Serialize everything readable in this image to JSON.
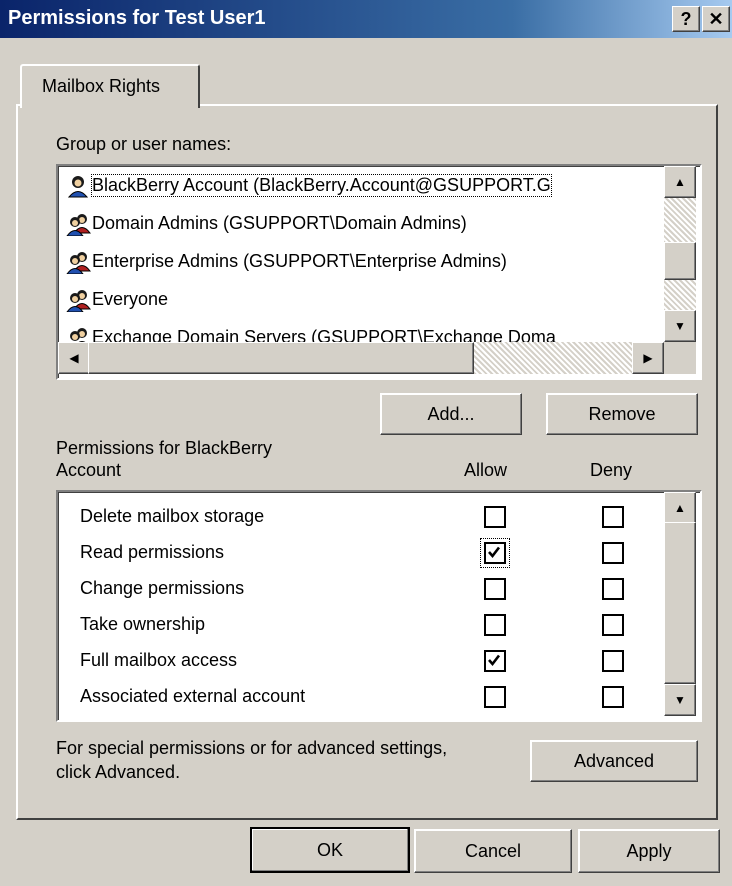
{
  "window": {
    "title": "Permissions for Test User1",
    "help_label": "?",
    "close_label": "✕"
  },
  "tab": {
    "label": "Mailbox Rights"
  },
  "groups": {
    "label": "Group or user names:",
    "items": [
      {
        "name": "BlackBerry Account (BlackBerry.Account@GSUPPORT.G",
        "icon": "single-user-icon",
        "selected": true
      },
      {
        "name": "Domain Admins (GSUPPORT\\Domain Admins)",
        "icon": "group-users-icon"
      },
      {
        "name": "Enterprise Admins (GSUPPORT\\Enterprise Admins)",
        "icon": "group-users-icon"
      },
      {
        "name": "Everyone",
        "icon": "group-users-icon"
      },
      {
        "name": "Exchange Domain Servers (GSUPPORT\\Exchange Doma",
        "icon": "group-users-icon"
      }
    ]
  },
  "buttons": {
    "add": "Add...",
    "remove": "Remove",
    "advanced": "Advanced",
    "ok": "OK",
    "cancel": "Cancel",
    "apply": "Apply"
  },
  "permissions": {
    "label_line1": "Permissions for BlackBerry",
    "label_line2": "Account",
    "allow_header": "Allow",
    "deny_header": "Deny",
    "items": [
      {
        "name": "Delete mailbox storage",
        "allow": false,
        "deny": false
      },
      {
        "name": "Read permissions",
        "allow": true,
        "deny": false
      },
      {
        "name": "Change permissions",
        "allow": false,
        "deny": false
      },
      {
        "name": "Take ownership",
        "allow": false,
        "deny": false
      },
      {
        "name": "Full mailbox access",
        "allow": true,
        "deny": false
      },
      {
        "name": "Associated external account",
        "allow": false,
        "deny": false
      }
    ]
  },
  "advanced_note": {
    "line1": "For special permissions or for advanced settings,",
    "line2": "click Advanced."
  }
}
